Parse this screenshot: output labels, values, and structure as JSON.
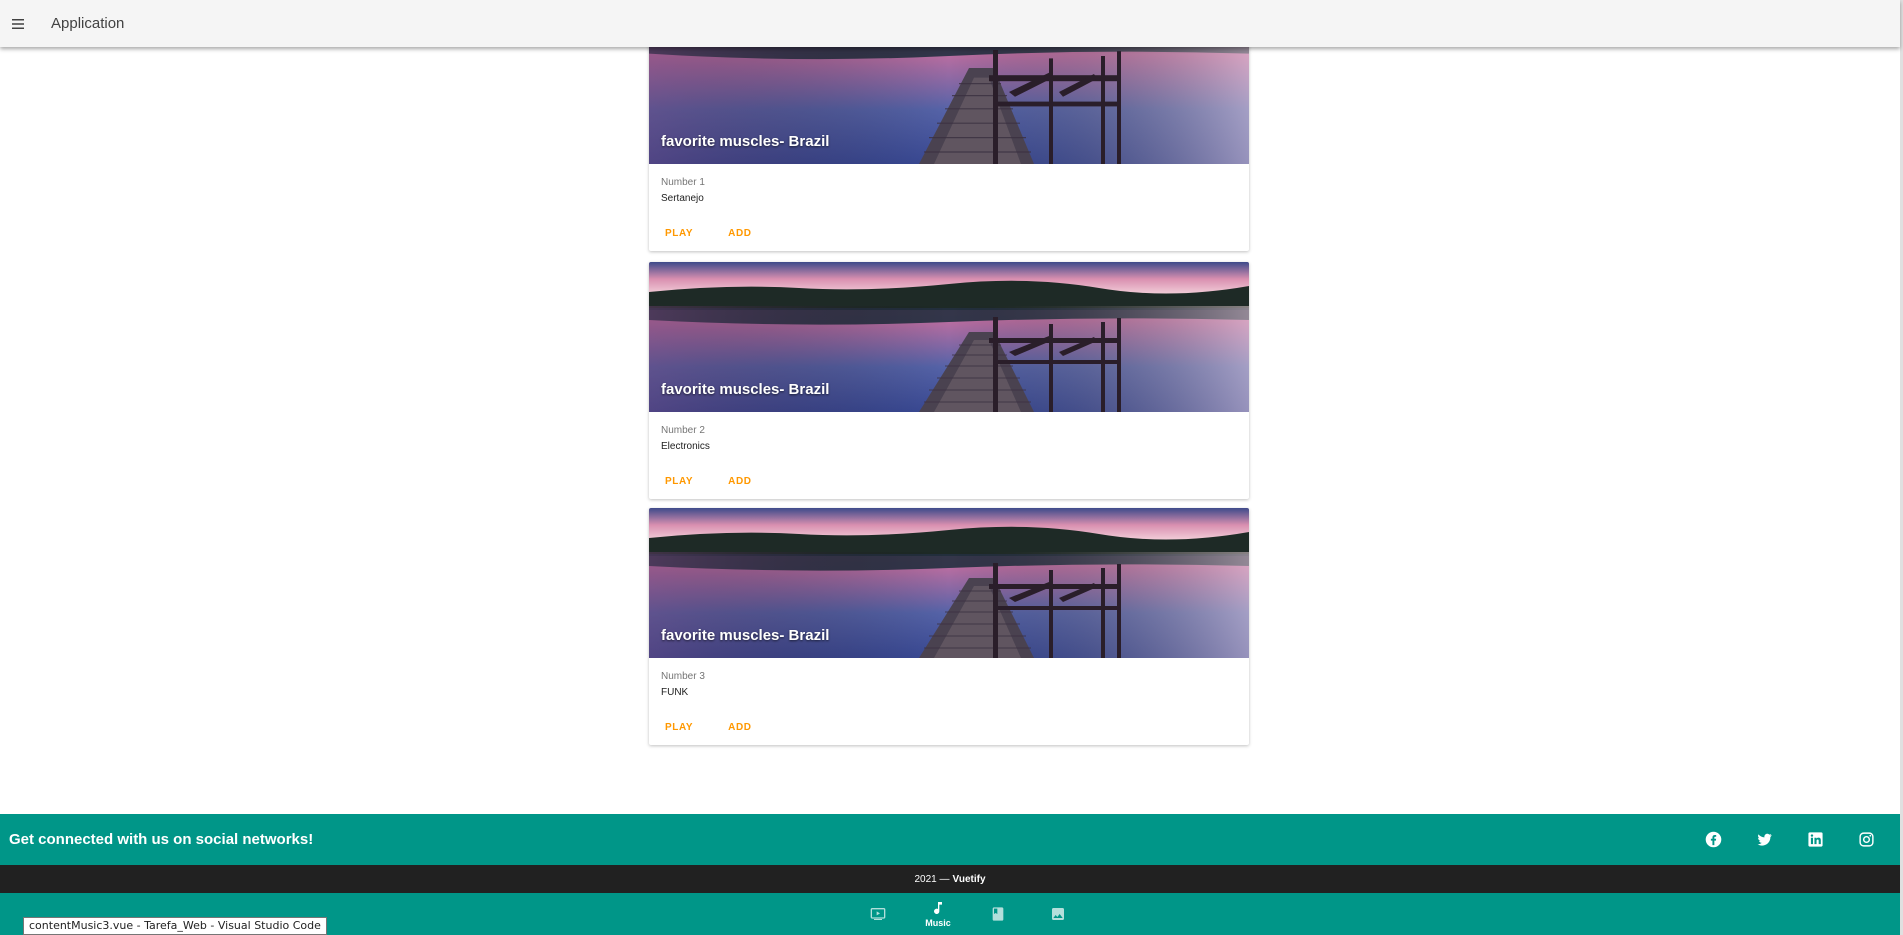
{
  "app_bar": {
    "title": "Application"
  },
  "cards": [
    {
      "title": "favorite muscles- Brazil",
      "subtitle": "Number 1",
      "text": "Sertanejo",
      "play_label": "PLAY",
      "add_label": "ADD"
    },
    {
      "title": "favorite muscles- Brazil",
      "subtitle": "Number 2",
      "text": "Electronics",
      "play_label": "PLAY",
      "add_label": "ADD"
    },
    {
      "title": "favorite muscles- Brazil",
      "subtitle": "Number 3",
      "text": "FUNK",
      "play_label": "PLAY",
      "add_label": "ADD"
    }
  ],
  "footer": {
    "headline": "Get connected with us on social networks!",
    "social_icons": [
      "facebook-icon",
      "twitter-icon",
      "linkedin-icon",
      "instagram-icon"
    ],
    "copyright_year": "2021 —",
    "copyright_brand": "Vuetify"
  },
  "bottom_nav": {
    "items": [
      {
        "icon": "video-icon",
        "label": ""
      },
      {
        "icon": "music-note-icon",
        "label": "Music"
      },
      {
        "icon": "book-icon",
        "label": ""
      },
      {
        "icon": "image-icon",
        "label": ""
      }
    ]
  },
  "tooltip": {
    "text": "contentMusic3.vue - Tarefa_Web - Visual Studio Code"
  },
  "colors": {
    "accent": "#ff9800",
    "teal": "#009688",
    "dark": "#212121",
    "app_bar": "#f5f5f5"
  }
}
